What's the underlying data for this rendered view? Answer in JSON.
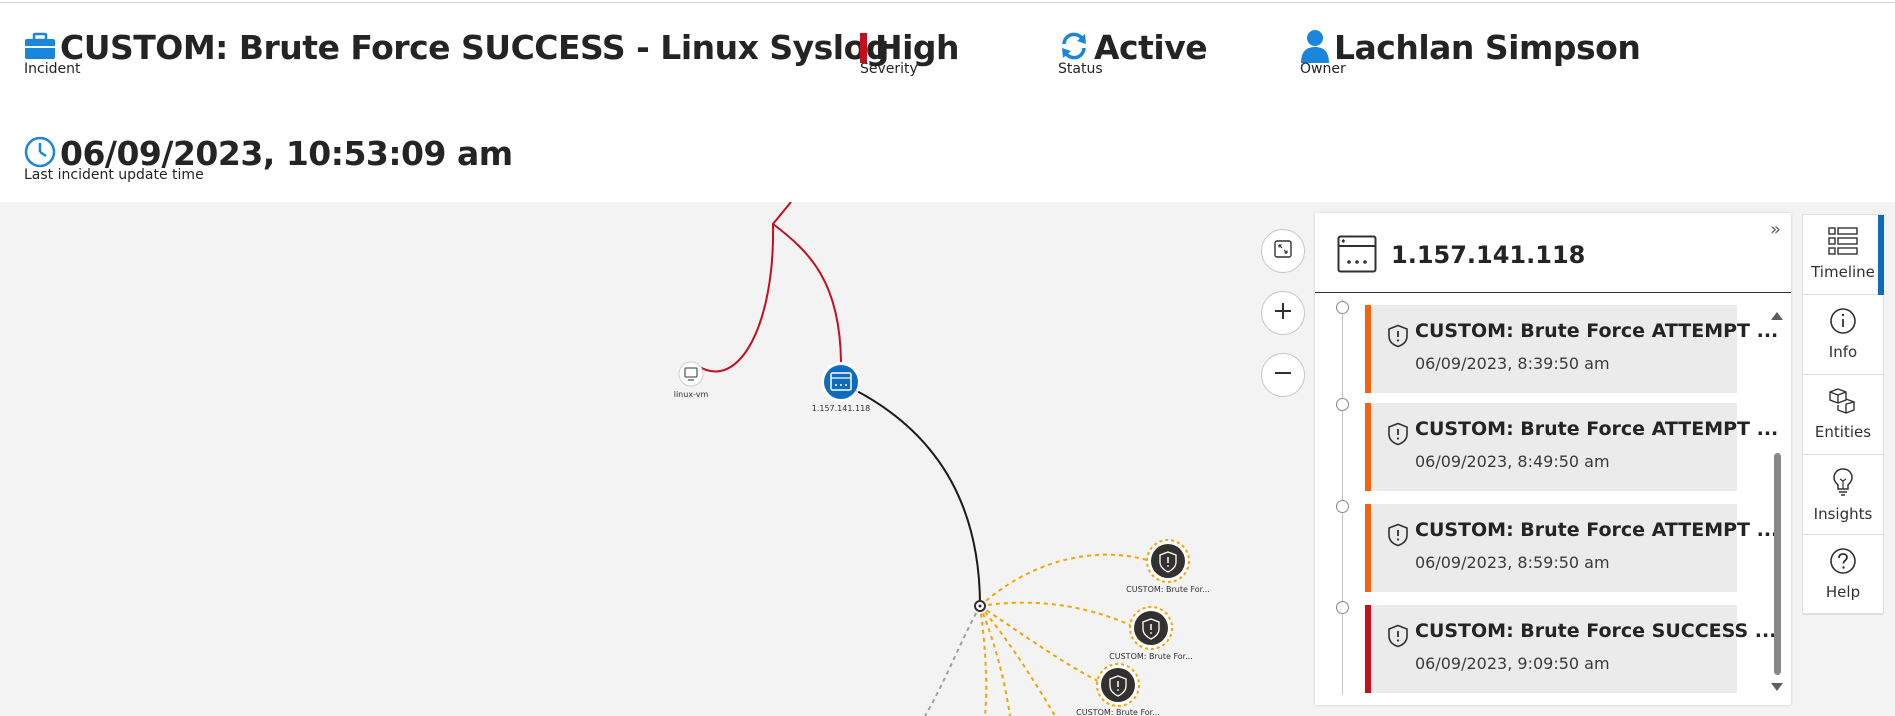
{
  "header": {
    "incident": {
      "value": "CUSTOM: Brute Force SUCCESS - Linux Syslog",
      "label": "Incident",
      "icon": "briefcase-icon"
    },
    "severity": {
      "value": "High",
      "label": "Severity",
      "color": "#c50f1f"
    },
    "status": {
      "value": "Active",
      "label": "Status",
      "icon": "refresh-icon"
    },
    "owner": {
      "value": "Lachlan Simpson",
      "label": "Owner",
      "icon": "person-icon"
    },
    "update_time": {
      "value": "06/09/2023, 10:53:09 am",
      "label": "Last incident update time",
      "icon": "clock-icon"
    }
  },
  "graph": {
    "nodes": [
      {
        "id": "linux-vm",
        "label": "linux-vm",
        "kind": "host"
      },
      {
        "id": "ip",
        "label": "1.157.141.118",
        "kind": "ip",
        "selected": true
      },
      {
        "id": "alert1",
        "label": "CUSTOM: Brute For...",
        "kind": "alert"
      },
      {
        "id": "alert2",
        "label": "CUSTOM: Brute For...",
        "kind": "alert"
      },
      {
        "id": "alert3",
        "label": "CUSTOM: Brute For...",
        "kind": "alert"
      }
    ],
    "colors": {
      "primary_edge": "#c50f1f",
      "alert_edge": "#f7a300",
      "selected_node": "#0f6cbd",
      "alert_node": "#323130"
    }
  },
  "zoom": {
    "fit_icon": "fit-screen-icon",
    "in_icon": "zoom-in-icon",
    "out_icon": "zoom-out-icon"
  },
  "panel": {
    "title": "1.157.141.118",
    "icon": "ip-entity-icon",
    "timeline": [
      {
        "title": "CUSTOM: Brute Force ATTEMPT ...",
        "time": "06/09/2023, 8:39:50 am",
        "severity_color": "#f7630c"
      },
      {
        "title": "CUSTOM: Brute Force ATTEMPT ...",
        "time": "06/09/2023, 8:49:50 am",
        "severity_color": "#f7630c"
      },
      {
        "title": "CUSTOM: Brute Force ATTEMPT ...",
        "time": "06/09/2023, 8:59:50 am",
        "severity_color": "#f7630c"
      },
      {
        "title": "CUSTOM: Brute Force SUCCESS ...",
        "time": "06/09/2023, 9:09:50 am",
        "severity_color": "#c50f1f"
      }
    ]
  },
  "tabs": [
    {
      "label": "Timeline",
      "icon": "timeline-icon",
      "active": true
    },
    {
      "label": "Info",
      "icon": "info-icon",
      "active": false
    },
    {
      "label": "Entities",
      "icon": "entities-icon",
      "active": false
    },
    {
      "label": "Insights",
      "icon": "lightbulb-icon",
      "active": false
    },
    {
      "label": "Help",
      "icon": "help-icon",
      "active": false
    }
  ]
}
